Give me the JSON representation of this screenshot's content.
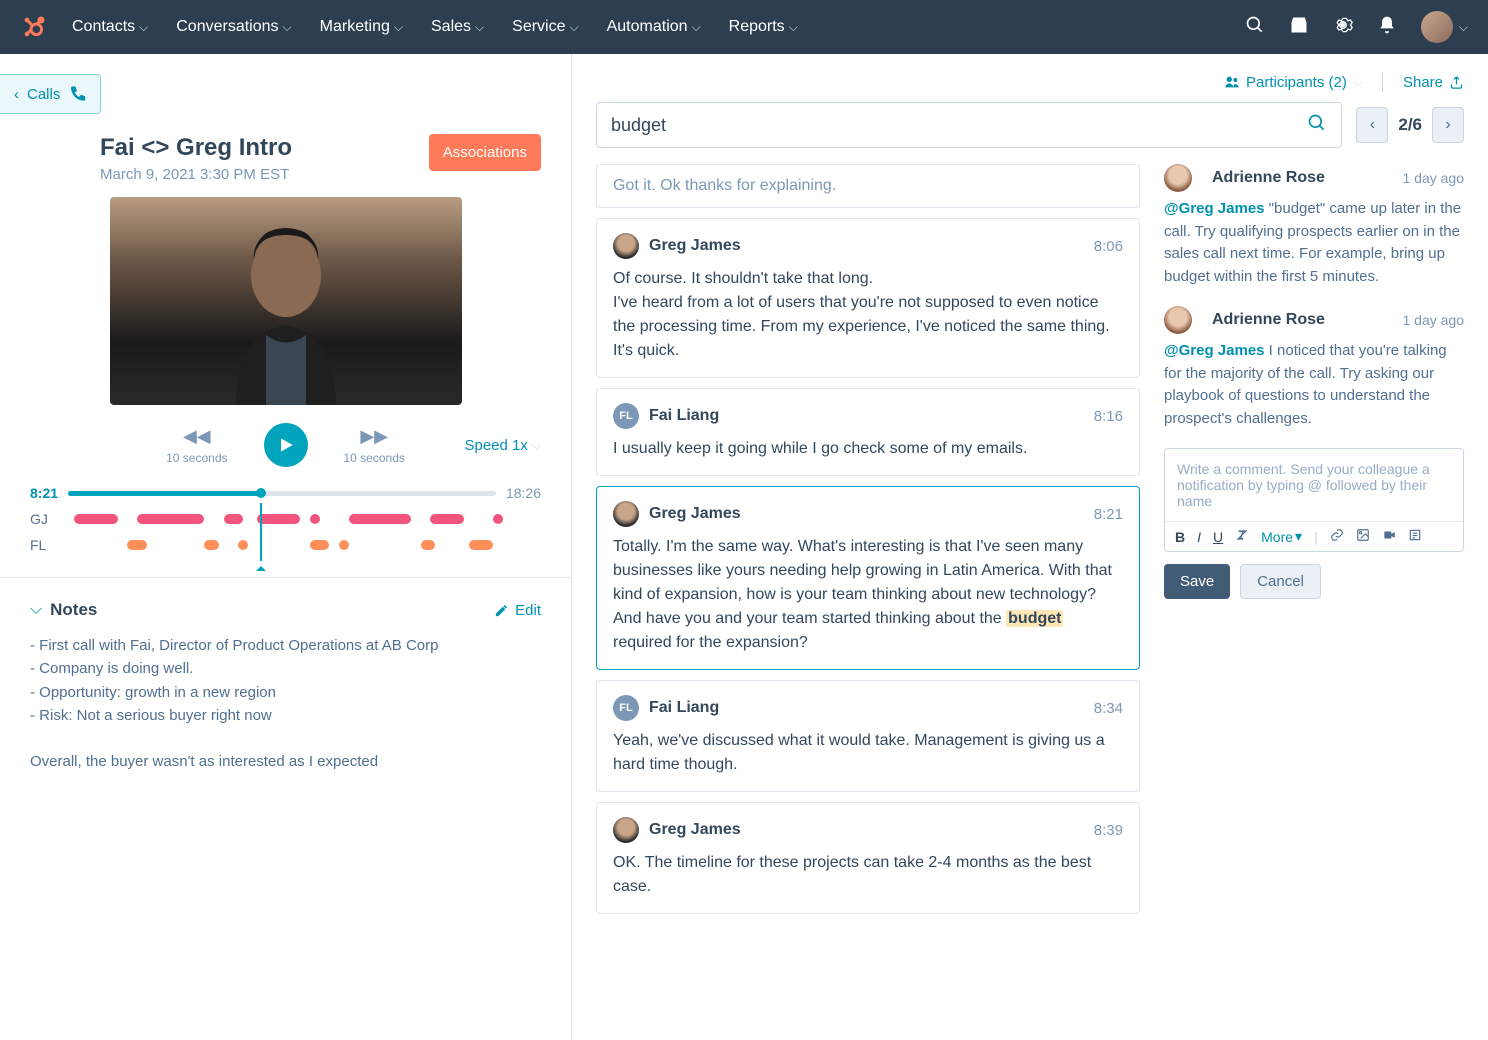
{
  "nav": {
    "items": [
      "Contacts",
      "Conversations",
      "Marketing",
      "Sales",
      "Service",
      "Automation",
      "Reports"
    ]
  },
  "back_label": "Calls",
  "header": {
    "title": "Fai <> Greg Intro",
    "subtitle": "March 9, 2021 3:30 PM EST",
    "associations": "Associations"
  },
  "playback": {
    "back_label": "10 seconds",
    "fwd_label": "10 seconds",
    "speed": "Speed 1x",
    "current": "8:21",
    "total": "18:26"
  },
  "speakers": {
    "gj": "GJ",
    "fl": "FL"
  },
  "notes": {
    "heading": "Notes",
    "edit": "Edit",
    "line1": "- First call with Fai, Director of Product Operations at AB Corp",
    "line2": "- Company is doing well.",
    "line3": "- Opportunity: growth in a new region",
    "line4": "- Risk: Not a serious buyer right now",
    "summary": "Overall, the buyer wasn't as interested as I expected"
  },
  "right": {
    "participants": "Participants (2)",
    "share": "Share"
  },
  "search": {
    "value": "budget",
    "pager": "2/6"
  },
  "transcript": {
    "prev": "Got it. Ok thanks for explaining.",
    "m1": {
      "name": "Greg James",
      "time": "8:06",
      "body": "Of course. It shouldn't take that long.\nI've heard from a lot of users that you're not supposed to even notice the processing time. From my experience, I've noticed the same thing. It's quick."
    },
    "m2": {
      "name": "Fai Liang",
      "avatar": "FL",
      "time": "8:16",
      "body": "I usually keep it going while I go check some of my emails."
    },
    "m3": {
      "name": "Greg James",
      "time": "8:21",
      "body_pre": "Totally. I'm the same way. What's interesting is that I've seen many businesses like yours needing help growing in Latin America. With that kind of expansion, how is your team thinking about new technology? And have you and your team started thinking about the ",
      "hl": "budget",
      "body_post": " required for the expansion?"
    },
    "m4": {
      "name": "Fai Liang",
      "avatar": "FL",
      "time": "8:34",
      "body": "Yeah, we've discussed what it would take. Management is giving us a hard time though."
    },
    "m5": {
      "name": "Greg James",
      "time": "8:39",
      "body": "OK. The timeline for these projects can take 2-4 months as the best case."
    }
  },
  "comments": {
    "c1": {
      "name": "Adrienne Rose",
      "time": "1 day ago",
      "mention": "@Greg James",
      "body": " \"budget\" came up later in the call. Try qualifying prospects earlier on in the sales call next time. For example, bring up budget within the first 5 minutes."
    },
    "c2": {
      "name": "Adrienne Rose",
      "time": "1 day ago",
      "mention": "@Greg James",
      "body": " I noticed that you're talking for the majority of the call. Try asking our playbook of questions to understand the prospect's challenges."
    },
    "placeholder": "Write a comment. Send your colleague a notification by typing @ followed by their name",
    "more": "More",
    "save": "Save",
    "cancel": "Cancel"
  }
}
